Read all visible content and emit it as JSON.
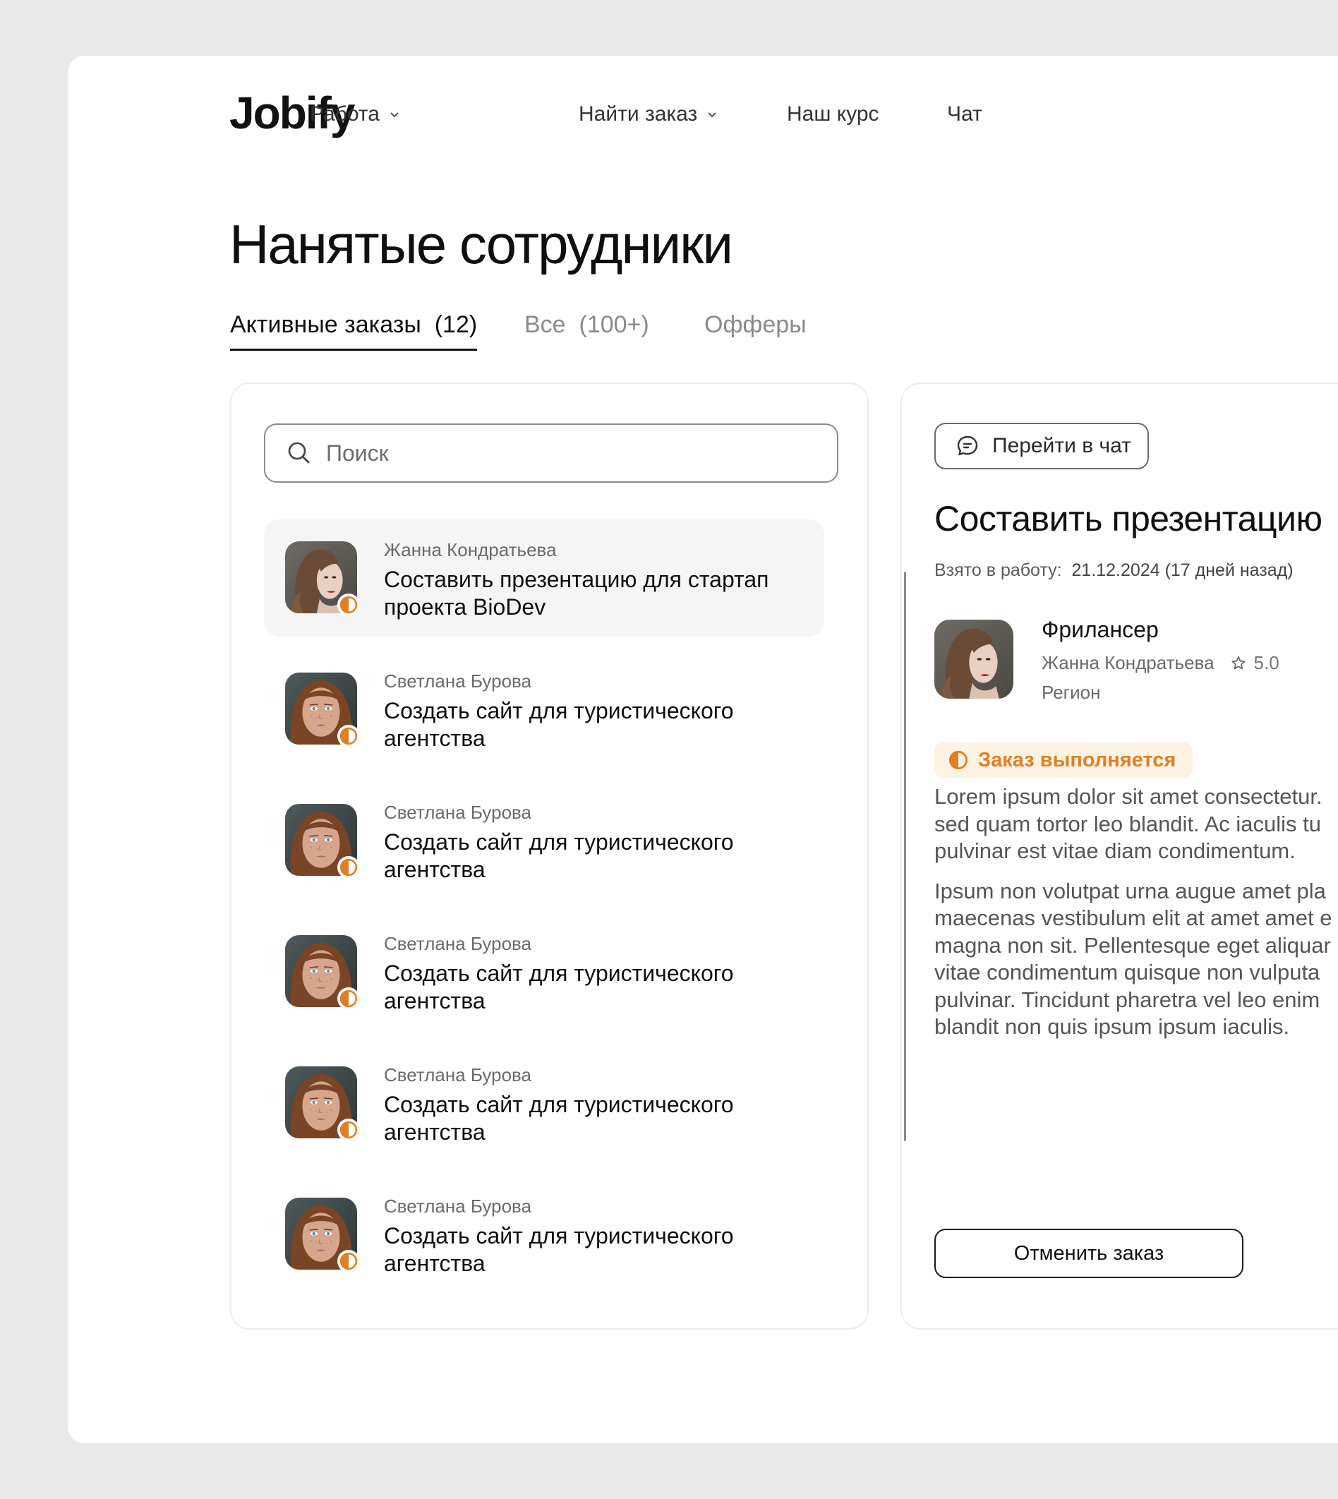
{
  "app": {
    "logo": "Jobify"
  },
  "nav": {
    "items": [
      {
        "label": "Работа",
        "has_dropdown": true
      },
      {
        "label": "Найти заказ",
        "has_dropdown": true
      },
      {
        "label": "Наш курс",
        "has_dropdown": false
      },
      {
        "label": "Чат",
        "has_dropdown": false
      }
    ]
  },
  "page": {
    "title": "Нанятые сотрудники"
  },
  "tabs": [
    {
      "label": "Активные заказы",
      "count": "(12)",
      "active": true
    },
    {
      "label": "Все",
      "count": "(100+)",
      "active": false
    },
    {
      "label": "Офферы",
      "count": "",
      "active": false
    }
  ],
  "search": {
    "placeholder": "Поиск",
    "value": ""
  },
  "orders": [
    {
      "name": "Жанна Кондратьева",
      "title": "Составить презентацию для стартап проекта BioDev",
      "avatar": "woman-red-lips",
      "selected": true
    },
    {
      "name": "Светлана Бурова",
      "title": "Создать сайт для туристического агентства",
      "avatar": "woman-freckles",
      "selected": false
    },
    {
      "name": "Светлана Бурова",
      "title": "Создать сайт для туристического агентства",
      "avatar": "woman-freckles",
      "selected": false
    },
    {
      "name": "Светлана Бурова",
      "title": "Создать сайт для туристического агентства",
      "avatar": "woman-freckles",
      "selected": false
    },
    {
      "name": "Светлана Бурова",
      "title": "Создать сайт для туристического агентства",
      "avatar": "woman-freckles",
      "selected": false
    },
    {
      "name": "Светлана Бурова",
      "title": "Создать сайт для туристического агентства",
      "avatar": "woman-freckles",
      "selected": false
    }
  ],
  "detail": {
    "chat_button": "Перейти в чат",
    "title": "Составить презентацию",
    "taken_label": "Взято в работу:",
    "taken_date": "21.12.2024 (17 дней назад)",
    "freelancer_role": "Фрилансер",
    "freelancer_name": "Жанна Кондратьева",
    "rating": "5.0",
    "region": "Регион",
    "status": "Заказ выполняется",
    "description": [
      "Lorem ipsum dolor sit amet consectetur.\nsed quam tortor leo blandit. Ac iaculis tu\npulvinar est vitae diam condimentum.",
      "Ipsum non volutpat urna augue amet pla\nmaecenas vestibulum elit at amet amet e\nmagna non sit. Pellentesque eget aliquar\nvitae condimentum quisque non vulputa\npulvinar. Tincidunt pharetra vel leo enim\nblandit non quis ipsum ipsum iaculis."
    ],
    "cancel_button": "Отменить заказ"
  },
  "colors": {
    "background": "#e9e9e9",
    "surface": "#ffffff",
    "accent_orange": "#e07f24",
    "badge_bg": "#fdf3e3",
    "selected_row": "#f5f5f5"
  },
  "icons": [
    "chevron-down-icon",
    "search-icon",
    "chat-bubble-icon",
    "star-icon",
    "half-circle-status-icon"
  ]
}
